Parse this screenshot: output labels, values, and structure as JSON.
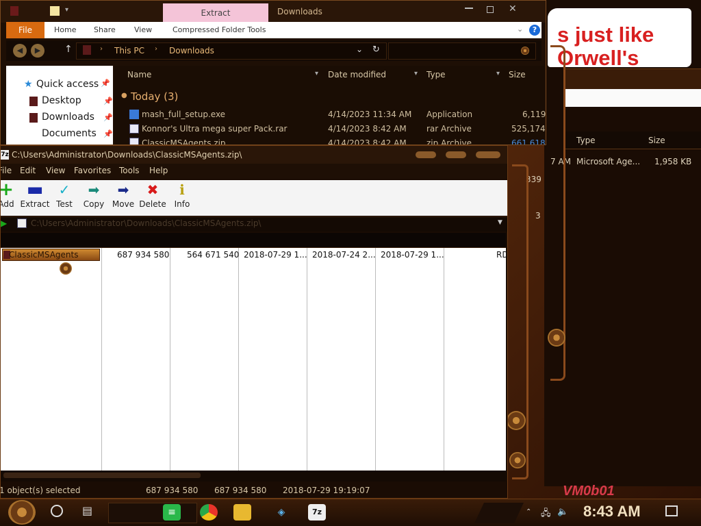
{
  "background": {
    "note_text": "s just like\nOrwell's",
    "file_row": {
      "time": "7 AM",
      "type": "Microsoft Age...",
      "size": "1,958 KB"
    },
    "header": {
      "type": "Type",
      "size": "Size"
    },
    "side_numbers": [
      "339",
      "3"
    ],
    "taskbar_label": "VM0b01"
  },
  "explorer": {
    "contextual_tab": "Extract",
    "title": "Downloads",
    "ribbon": {
      "file": "File",
      "tabs": [
        "Home",
        "Share",
        "View",
        "Compressed Folder Tools"
      ]
    },
    "breadcrumb": [
      "This PC",
      "Downloads"
    ],
    "nav": {
      "items": [
        "Quick access",
        "Desktop",
        "Downloads",
        "Documents"
      ]
    },
    "columns": {
      "name": "Name",
      "date": "Date modified",
      "type": "Type",
      "size": "Size"
    },
    "group": "Today (3)",
    "files": [
      {
        "name": "mash_full_setup.exe",
        "date": "4/14/2023 11:34 AM",
        "type": "Application",
        "size": "6,119"
      },
      {
        "name": "Konnor's Ultra mega super Pack.rar",
        "date": "4/14/2023 8:42 AM",
        "type": "rar Archive",
        "size": "525,174"
      },
      {
        "name": "ClassicMSAgents.zip",
        "date": "4/14/2023 8:42 AM",
        "type": "zip Archive",
        "size": "661,618"
      }
    ]
  },
  "zip": {
    "title": "C:\\Users\\Administrator\\Downloads\\ClassicMSAgents.zip\\",
    "menu": [
      "File",
      "Edit",
      "View",
      "Favorites",
      "Tools",
      "Help"
    ],
    "toolbar": [
      {
        "label": "Add",
        "icon": "plus-icon",
        "color": "#1aa81a"
      },
      {
        "label": "Extract",
        "icon": "minus-icon",
        "color": "#1a2aa8"
      },
      {
        "label": "Test",
        "icon": "check-icon",
        "color": "#18b0c8"
      },
      {
        "label": "Copy",
        "icon": "arrow-right-icon",
        "color": "#1a8a7a"
      },
      {
        "label": "Move",
        "icon": "arrow-right-icon",
        "color": "#1a2a8a"
      },
      {
        "label": "Delete",
        "icon": "x-icon",
        "color": "#d81a1a"
      },
      {
        "label": "Info",
        "icon": "info-icon",
        "color": "#b8a010"
      }
    ],
    "address": "C:\\Users\\Administrator\\Downloads\\ClassicMSAgents.zip\\",
    "row": {
      "name": "ClassicMSAgents",
      "size": "687 934 580",
      "packed": "564 671 540",
      "modified": "2018-07-29 1...",
      "created": "2018-07-24 2...",
      "accessed": "2018-07-29 1...",
      "attr": "RD"
    },
    "status": {
      "selected": "1 object(s) selected",
      "size": "687 934 580",
      "size2": "687 934 580",
      "date": "2018-07-29 19:19:07"
    }
  },
  "taskbar": {
    "clock": "8:43 AM"
  },
  "colors": {
    "accent": "#d86a10",
    "brown": "#1e0f05",
    "copper": "#8a4a1c"
  }
}
